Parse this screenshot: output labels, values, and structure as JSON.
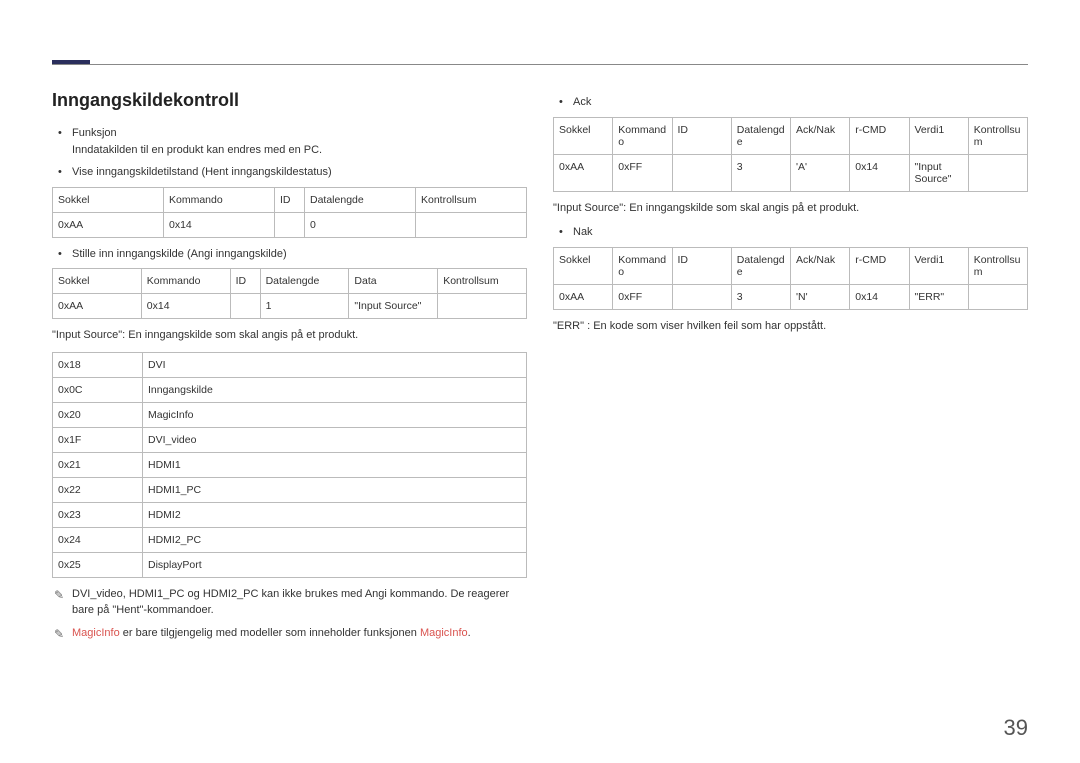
{
  "pageNumber": "39",
  "left": {
    "title": "Inngangskildekontroll",
    "funksjonLabel": "Funksjon",
    "funksjonText": "Inndatakilden til en produkt kan endres med en PC.",
    "viseLabel": "Vise inngangskildetilstand (Hent inngangskildestatus)",
    "table1": {
      "headers": [
        "Sokkel",
        "Kommando",
        "ID",
        "Datalengde",
        "Kontrollsum"
      ],
      "row": [
        "0xAA",
        "0x14",
        "",
        "0",
        ""
      ]
    },
    "stilleLabel": "Stille inn inngangskilde (Angi inngangskilde)",
    "table2": {
      "headers": [
        "Sokkel",
        "Kommando",
        "ID",
        "Datalengde",
        "Data",
        "Kontrollsum"
      ],
      "row": [
        "0xAA",
        "0x14",
        "",
        "1",
        "\"Input Source\"",
        ""
      ]
    },
    "inputSourceDesc": "\"Input Source\": En inngangskilde som skal angis på et produkt.",
    "codesTable": [
      [
        "0x18",
        "DVI"
      ],
      [
        "0x0C",
        "Inngangskilde"
      ],
      [
        "0x20",
        "MagicInfo"
      ],
      [
        "0x1F",
        "DVI_video"
      ],
      [
        "0x21",
        "HDMI1"
      ],
      [
        "0x22",
        "HDMI1_PC"
      ],
      [
        "0x23",
        "HDMI2"
      ],
      [
        "0x24",
        "HDMI2_PC"
      ],
      [
        "0x25",
        "DisplayPort"
      ]
    ],
    "note1": "DVI_video, HDMI1_PC og HDMI2_PC kan ikke brukes med Angi kommando. De reagerer bare på \"Hent\"-kommandoer.",
    "note2a": "MagicInfo",
    "note2b": " er bare tilgjengelig med modeller som inneholder funksjonen ",
    "note2c": "MagicInfo",
    "note2d": "."
  },
  "right": {
    "ackLabel": "Ack",
    "ackTable": {
      "headers": [
        "Sokkel",
        "Kommando",
        "ID",
        "Datalengde",
        "Ack/Nak",
        "r-CMD",
        "Verdi1",
        "Kontrollsum"
      ],
      "row": [
        "0xAA",
        "0xFF",
        "",
        "3",
        "'A'",
        "0x14",
        "\"Input Source\"",
        ""
      ]
    },
    "ackDesc": "\"Input Source\": En inngangskilde som skal angis på et produkt.",
    "nakLabel": "Nak",
    "nakTable": {
      "headers": [
        "Sokkel",
        "Kommando",
        "ID",
        "Datalengde",
        "Ack/Nak",
        "r-CMD",
        "Verdi1",
        "Kontrollsum"
      ],
      "row": [
        "0xAA",
        "0xFF",
        "",
        "3",
        "'N'",
        "0x14",
        "\"ERR\"",
        ""
      ]
    },
    "nakDesc": "\"ERR\" : En kode som viser hvilken feil som har oppstått."
  }
}
